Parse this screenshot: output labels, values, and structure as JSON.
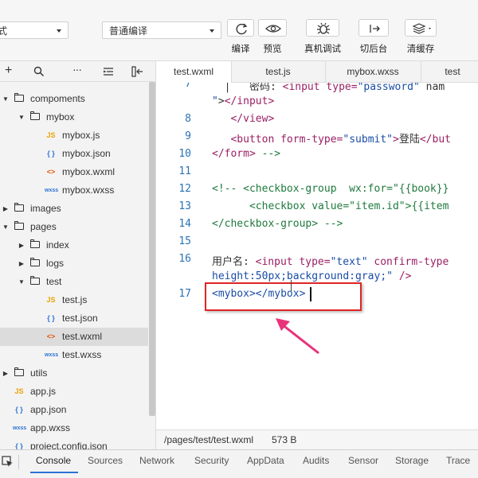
{
  "toolbar": {
    "mode_select": "式",
    "compile_select": "普通编译",
    "buttons": [
      {
        "label": "编译"
      },
      {
        "label": "预览"
      },
      {
        "label": "真机调试"
      },
      {
        "label": "切后台"
      },
      {
        "label": "清缓存"
      }
    ]
  },
  "tabs": [
    {
      "label": "test.wxml"
    },
    {
      "label": "test.js"
    },
    {
      "label": "mybox.wxss"
    },
    {
      "label": "test"
    }
  ],
  "tree": [
    {
      "type": "folder",
      "label": "compoments"
    },
    {
      "type": "folder",
      "label": "mybox"
    },
    {
      "type": "JS",
      "label": "mybox.js"
    },
    {
      "type": "{ }",
      "label": "mybox.json"
    },
    {
      "type": "<>",
      "label": "mybox.wxml"
    },
    {
      "type": "wxss",
      "label": "mybox.wxss"
    },
    {
      "type": "folder",
      "label": "images"
    },
    {
      "type": "folder",
      "label": "pages"
    },
    {
      "type": "folder",
      "label": "index"
    },
    {
      "type": "folder",
      "label": "logs"
    },
    {
      "type": "folder",
      "label": "test"
    },
    {
      "type": "JS",
      "label": "test.js"
    },
    {
      "type": "{ }",
      "label": "test.json"
    },
    {
      "type": "<>",
      "label": "test.wxml"
    },
    {
      "type": "wxss",
      "label": "test.wxss"
    },
    {
      "type": "folder",
      "label": "utils"
    },
    {
      "type": "JS",
      "label": "app.js"
    },
    {
      "type": "{ }",
      "label": "app.json"
    },
    {
      "type": "wxss",
      "label": "app.wxss"
    },
    {
      "type": "{ }",
      "label": "project.config.json"
    }
  ],
  "editor": {
    "lines": [
      {
        "n": "7",
        "parts": [
          [
            "t",
            "  |   "
          ],
          [
            "t",
            "密码: "
          ],
          [
            "kw",
            "<input"
          ],
          [
            "t",
            " "
          ],
          [
            "kw",
            "type="
          ],
          [
            "str",
            "\"password\""
          ],
          [
            "t",
            " nam"
          ]
        ]
      },
      {
        "n": "",
        "parts": [
          [
            "str",
            "\""
          ],
          [
            "t",
            ">"
          ],
          [
            "kw",
            "</input>"
          ]
        ]
      },
      {
        "n": "8",
        "parts": [
          [
            "t",
            "   "
          ],
          [
            "kw",
            "</view>"
          ]
        ]
      },
      {
        "n": "9",
        "parts": [
          [
            "t",
            "   "
          ],
          [
            "kw",
            "<button"
          ],
          [
            "t",
            " "
          ],
          [
            "kw",
            "form-type="
          ],
          [
            "str",
            "\"submit\""
          ],
          [
            "kw",
            ">"
          ],
          [
            "t",
            "登陆"
          ],
          [
            "kw",
            "</but"
          ]
        ]
      },
      {
        "n": "10",
        "parts": [
          [
            "kw",
            "</form>"
          ],
          [
            "t",
            " "
          ],
          [
            "cmt",
            "-->"
          ]
        ]
      },
      {
        "n": "11",
        "parts": [
          [
            "t",
            ""
          ]
        ]
      },
      {
        "n": "12",
        "parts": [
          [
            "cmt",
            "<!-- <checkbox-group  wx:for=\"{{book}}"
          ]
        ]
      },
      {
        "n": "13",
        "parts": [
          [
            "cmt",
            "      <checkbox value=\"item.id\">{{item"
          ]
        ]
      },
      {
        "n": "14",
        "parts": [
          [
            "cmt",
            "</checkbox-group> -->"
          ]
        ]
      },
      {
        "n": "15",
        "parts": [
          [
            "t",
            ""
          ]
        ]
      },
      {
        "n": "16",
        "parts": [
          [
            "t",
            "用户名: "
          ],
          [
            "kw",
            "<input"
          ],
          [
            "t",
            " "
          ],
          [
            "kw",
            "type="
          ],
          [
            "str",
            "\"text\""
          ],
          [
            "t",
            " "
          ],
          [
            "kw",
            "confirm-type"
          ]
        ]
      },
      {
        "n": "",
        "parts": [
          [
            "sty",
            "height:50px;background:gray;"
          ],
          [
            "str",
            "\""
          ],
          [
            "t",
            " "
          ],
          [
            "kw",
            "/>"
          ]
        ]
      },
      {
        "n": "17",
        "parts": [
          [
            "str",
            "<mybox>"
          ],
          [
            "str",
            "</mybox>"
          ]
        ]
      }
    ]
  },
  "status": {
    "path": "/pages/test/test.wxml",
    "size": "573 B"
  },
  "devtools": {
    "tabs": [
      "Console",
      "Sources",
      "Network",
      "Security",
      "AppData",
      "Audits",
      "Sensor",
      "Storage",
      "Trace"
    ]
  },
  "colors": {
    "highlight_box": "#e02424",
    "arrow": "#e8337a",
    "active_tab_underline": "#2a72d5"
  }
}
